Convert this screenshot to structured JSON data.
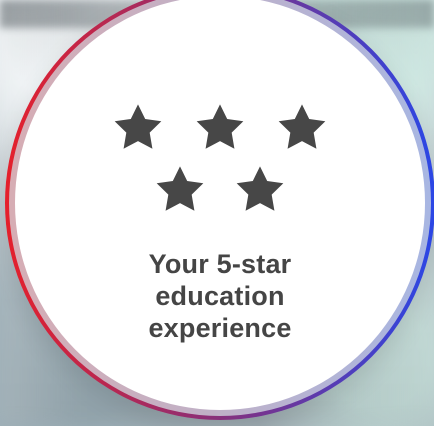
{
  "badge": {
    "rating": 5,
    "icon_name": "star-icon",
    "text_lines": [
      "Your 5-star",
      "education",
      "experience"
    ],
    "colors": {
      "ring_start": "#e5202b",
      "ring_mid": "#8a2f78",
      "ring_end": "#2b47e6",
      "star_fill": "#474747",
      "text": "#454545",
      "badge_fill": "#ffffff"
    }
  }
}
